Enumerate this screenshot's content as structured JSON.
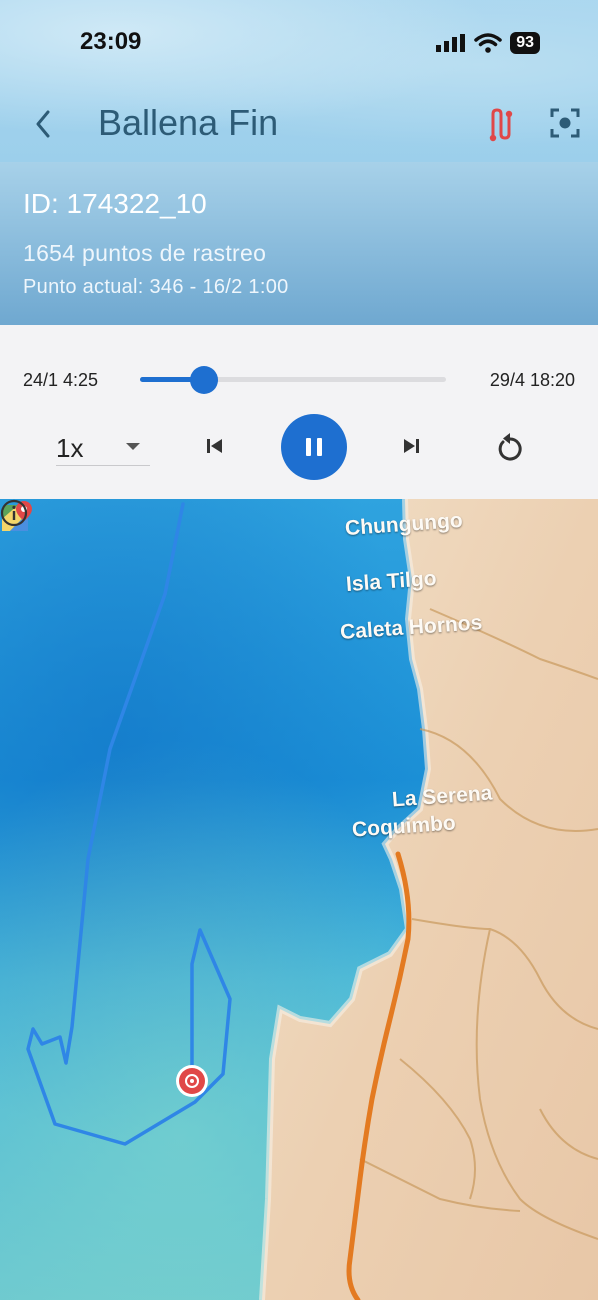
{
  "status_bar": {
    "time": "23:09",
    "battery": "93"
  },
  "header": {
    "title": "Ballena Fin",
    "back_icon": "chevron-left-icon",
    "route_icon": "route-icon",
    "focus_icon": "focus-icon",
    "accent": "#e04848"
  },
  "info": {
    "id": "ID: 174322_10",
    "points": "1654 puntos de rastreo",
    "current": "Punto actual: 346 - 16/2 1:00"
  },
  "playback": {
    "start": "24/1 4:25",
    "end": "29/4 18:20",
    "progress": 0.21,
    "speed": "1x",
    "playing": true,
    "accent": "#1e6fd0"
  },
  "map": {
    "places": [
      "Chungungo",
      "Isla Tilgo",
      "Caleta Hornos",
      "La Serena",
      "Coquimbo"
    ],
    "track_color": "#2f86e6",
    "marker_color": "#e04848"
  }
}
